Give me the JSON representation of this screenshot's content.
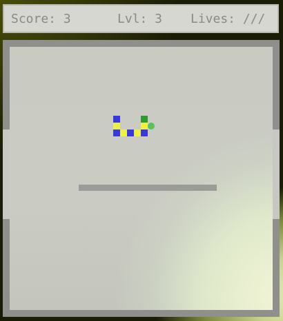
{
  "hud": {
    "score_text": "Score: 3",
    "level_text": "Lvl: 3",
    "lives_text": "Lives: ///"
  },
  "game": {
    "score": 3,
    "level": 3,
    "lives": 3,
    "colors": {
      "snake_blue": "#3838e0",
      "snake_yellow": "#eef042",
      "snake_head": "#2f9a2f",
      "food": "#5ac25a",
      "wall": "#9b9c97",
      "border": "#8f908b",
      "field": "#c9cbc3"
    }
  }
}
